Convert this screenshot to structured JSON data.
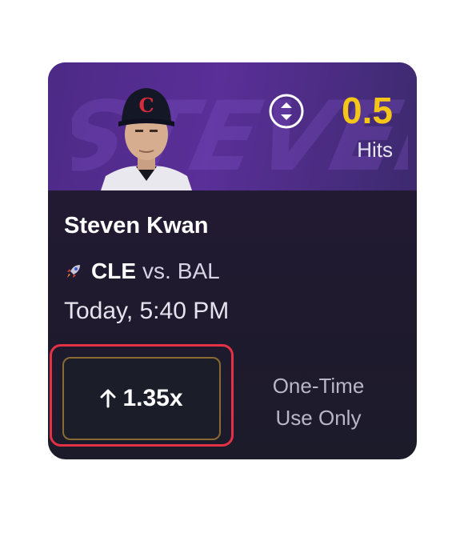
{
  "card": {
    "hero": {
      "watermark_text": "STEVEN",
      "cap_letter": "C"
    },
    "line": {
      "value": "0.5",
      "stat": "Hits",
      "icon": "up-down-toggle-icon"
    },
    "player_name": "Steven Kwan",
    "matchup": {
      "icon": "rocket-icon",
      "team": "CLE",
      "vs": "vs.",
      "opponent": "BAL"
    },
    "game_time": "Today, 5:40 PM",
    "boost": {
      "arrow_icon": "arrow-up-icon",
      "label": "1.35x"
    },
    "note": {
      "line1": "One-Time",
      "line2": "Use Only"
    }
  },
  "colors": {
    "accent": "#f5c518",
    "hero": "#5a2f98",
    "highlight": "#e53146",
    "boost_border": "#8a6a33"
  }
}
